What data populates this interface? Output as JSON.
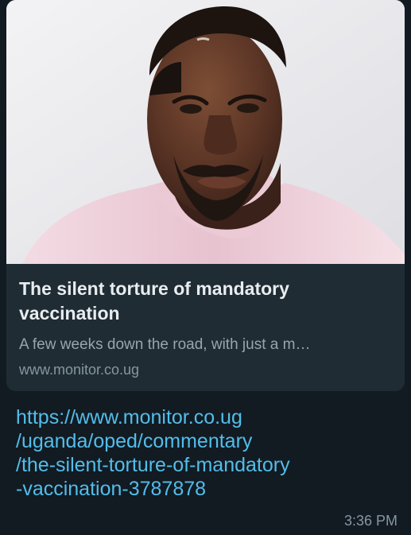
{
  "link_preview": {
    "title": "The silent torture of mandatory vaccination",
    "description": "A few weeks down the road, with just a m…",
    "domain": "www.monitor.co.ug",
    "image": "portrait-photo"
  },
  "message": {
    "url_lines": [
      "https://www.monitor.co.ug",
      "/uganda/oped/commentary",
      "/the-silent-torture-of-mandatory",
      "-vaccination-3787878"
    ],
    "time": "3:36 PM"
  },
  "colors": {
    "background": "#121b22",
    "card": "#1f2c34",
    "link": "#53bdeb",
    "title": "#e9edef",
    "secondary": "#8696a0"
  }
}
